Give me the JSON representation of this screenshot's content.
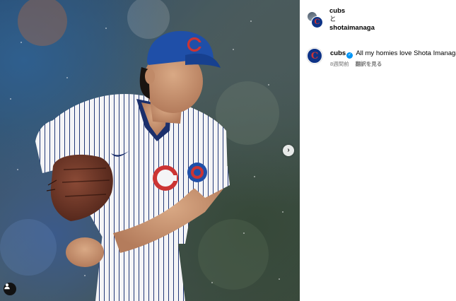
{
  "post": {
    "collaborators": [
      "cubs",
      "shotaimanaga"
    ],
    "collab_joiner": "と",
    "caption": {
      "username": "cubs",
      "verified": true,
      "text": "All my homies love Shota Imanaga",
      "time_ago": "8週間前",
      "see_translation": "翻訳を見る"
    }
  },
  "icons": {
    "carousel_next": "chevron-right-icon",
    "user_tags": "person-icon",
    "verified": "verified-badge-icon"
  },
  "colors": {
    "cubs_blue": "#0e3386",
    "cubs_red": "#cc3433",
    "verified_blue": "#0095f6"
  }
}
